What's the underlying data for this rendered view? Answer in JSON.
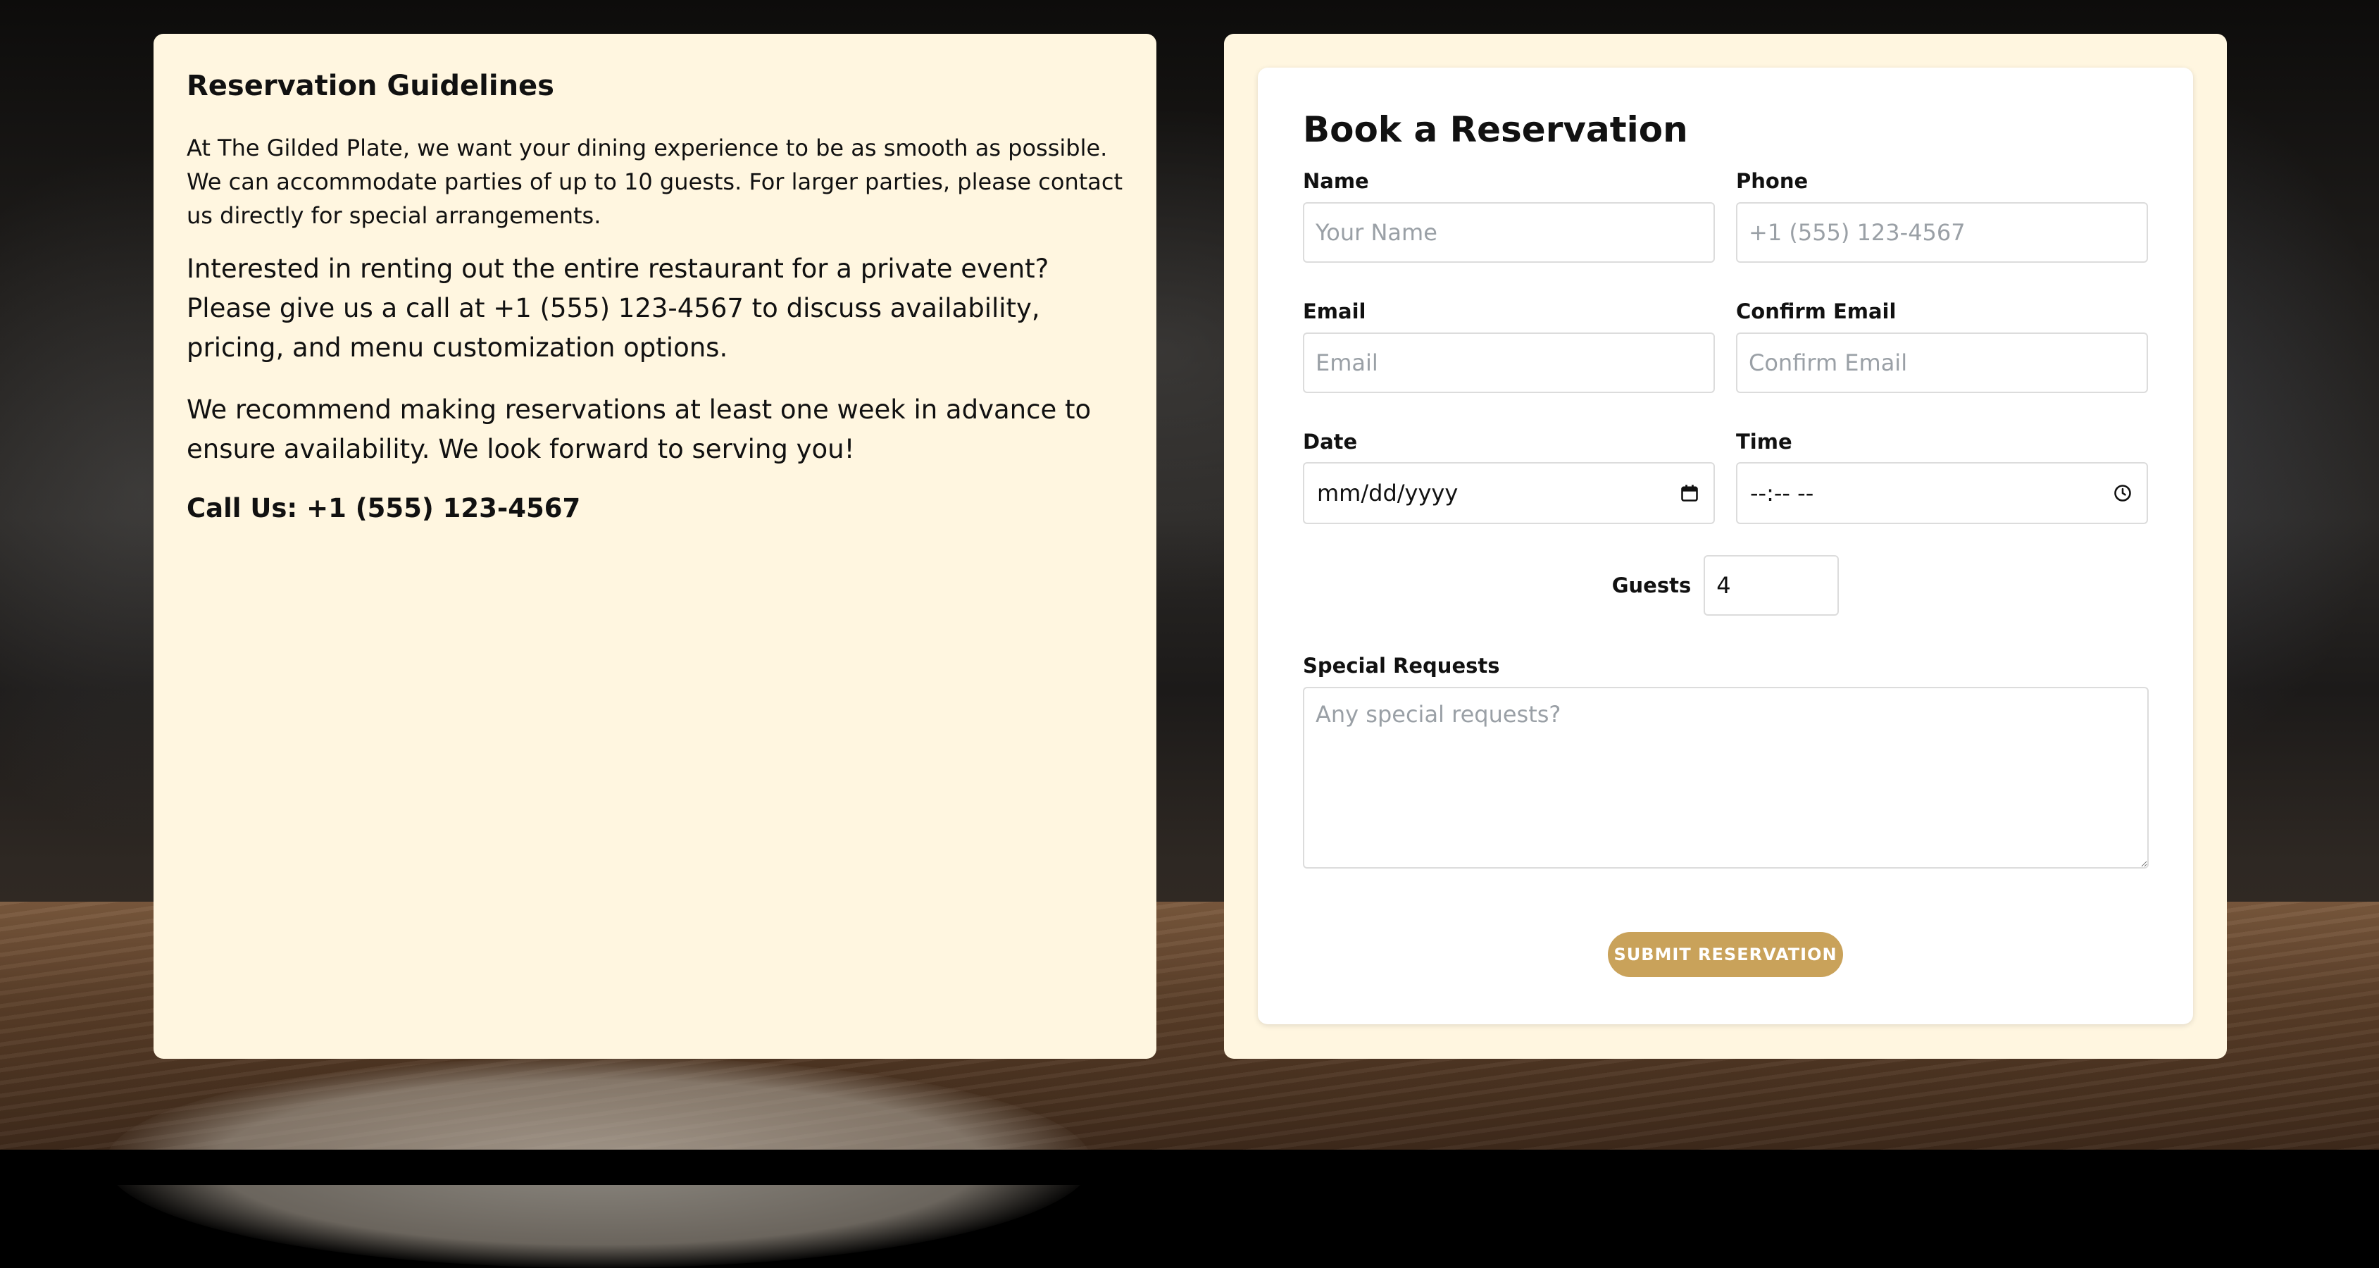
{
  "guidelines": {
    "title": "Reservation Guidelines",
    "paragraph_1": "At The Gilded Plate, we want your dining experience to be as smooth as possible. We can accommodate parties of up to 10 guests. For larger parties, please contact us directly for special arrangements.",
    "paragraph_2": "Interested in renting out the entire restaurant for a private event? Please give us a call at +1 (555) 123-4567 to discuss availability, pricing, and menu customization options.",
    "paragraph_3": "We recommend making reservations at least one week in advance to ensure availability. We look forward to serving you!",
    "call_us": "Call Us: +1 (555) 123-4567"
  },
  "form": {
    "title": "Book a Reservation",
    "name": {
      "label": "Name",
      "placeholder": "Your Name",
      "value": ""
    },
    "phone": {
      "label": "Phone",
      "placeholder": "+1 (555) 123-4567",
      "value": ""
    },
    "email": {
      "label": "Email",
      "placeholder": "Email",
      "value": ""
    },
    "confirm_email": {
      "label": "Confirm Email",
      "placeholder": "Confirm Email",
      "value": ""
    },
    "date": {
      "label": "Date",
      "display": "mm/dd/yyyy",
      "icon": "calendar-icon"
    },
    "time": {
      "label": "Time",
      "display": "--:-- --",
      "icon": "clock-icon"
    },
    "guests": {
      "label": "Guests",
      "value": "4"
    },
    "special_requests": {
      "label": "Special Requests",
      "placeholder": "Any special requests?",
      "value": ""
    },
    "submit_label": "SUBMIT RESERVATION"
  },
  "colors": {
    "panel_background": "#fff6e0",
    "card_background": "#ffffff",
    "accent": "#c9a25a",
    "input_border": "#dcdcdc",
    "placeholder": "#9aa0a6"
  }
}
